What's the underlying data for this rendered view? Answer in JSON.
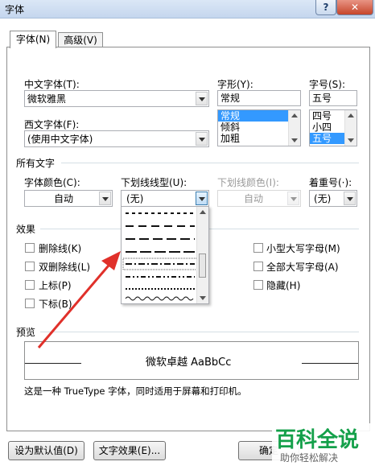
{
  "window": {
    "title": "字体",
    "help": "?",
    "close": "✕"
  },
  "tabs": [
    {
      "label": "字体(N)"
    },
    {
      "label": "高级(V)"
    }
  ],
  "font": {
    "chinese_label": "中文字体(T):",
    "chinese_value": "微软雅黑",
    "western_label": "西文字体(F):",
    "western_value": "(使用中文字体)",
    "style_label": "字形(Y):",
    "style_value": "常规",
    "style_options": [
      "常规",
      "倾斜",
      "加粗"
    ],
    "size_label": "字号(S):",
    "size_value": "五号",
    "size_options": [
      "四号",
      "小四",
      "五号"
    ]
  },
  "all_text": {
    "heading": "所有文字",
    "color_label": "字体颜色(C):",
    "color_value": "自动",
    "underline_label": "下划线线型(U):",
    "underline_value": "(无)",
    "underline_color_label": "下划线颜色(I):",
    "underline_color_value": "自动",
    "emphasis_label": "着重号(·):",
    "emphasis_value": "(无)"
  },
  "effects": {
    "heading": "效果",
    "left": [
      "删除线(K)",
      "双删除线(L)",
      "上标(P)",
      "下标(B)"
    ],
    "right": [
      "小型大写字母(M)",
      "全部大写字母(A)",
      "隐藏(H)"
    ]
  },
  "preview": {
    "heading": "预览",
    "text": "微软卓越  AaBbCc",
    "note": "这是一种 TrueType 字体，同时适用于屏幕和打印机。"
  },
  "buttons": {
    "default": "设为默认值(D)",
    "effects": "文字效果(E)...",
    "ok": "确定"
  },
  "watermark": {
    "brand": "百科全说",
    "tagline": "助你轻松解决"
  },
  "colors": {
    "accent": "#3399ff",
    "arrow": "#e0302a",
    "brand": "#14a04a"
  }
}
